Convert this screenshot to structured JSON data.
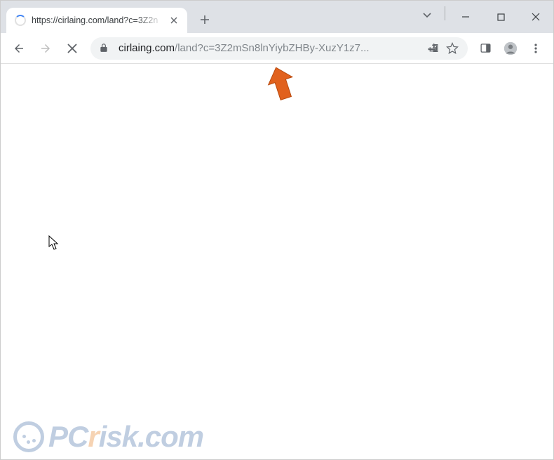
{
  "tab": {
    "title": "https://cirlaing.com/land?c=3Z2n"
  },
  "addressbar": {
    "host": "cirlaing.com",
    "path": "/land?c=3Z2mSn8lnYiybZHBy-XuzY1z7..."
  },
  "watermark": {
    "prefix": "PC",
    "r": "r",
    "suffix": "isk.com"
  },
  "icons": {
    "close": "close-icon",
    "newtab": "plus-icon",
    "tabsearch": "chevron-down-icon",
    "minimize": "minimize-icon",
    "maximize": "maximize-icon",
    "winclose": "close-icon",
    "back": "arrow-left-icon",
    "forward": "arrow-right-icon",
    "stop": "close-icon",
    "lock": "lock-icon",
    "share": "share-icon",
    "star": "star-icon",
    "sidepanel": "panel-icon",
    "profile": "person-icon",
    "menu": "dots-vertical-icon"
  }
}
